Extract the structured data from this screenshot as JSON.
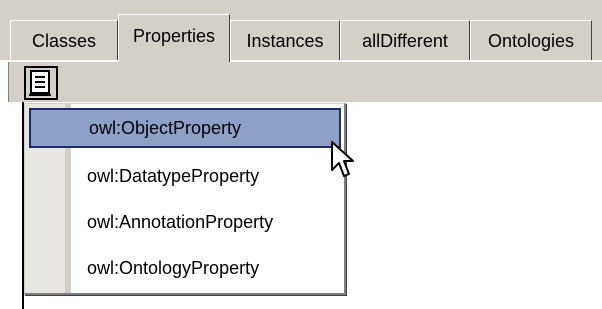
{
  "tabs": [
    {
      "label": "Classes",
      "active": false
    },
    {
      "label": "Properties",
      "active": true
    },
    {
      "label": "Instances",
      "active": false
    },
    {
      "label": "allDifferent",
      "active": false
    },
    {
      "label": "Ontologies",
      "active": false
    }
  ],
  "toolbar": {
    "button_icon": "list-icon"
  },
  "menu": {
    "items": [
      {
        "label": "owl:ObjectProperty",
        "highlighted": true
      },
      {
        "label": "owl:DatatypeProperty",
        "highlighted": false
      },
      {
        "label": "owl:AnnotationProperty",
        "highlighted": false
      },
      {
        "label": "owl:OntologyProperty",
        "highlighted": false
      }
    ]
  },
  "colors": {
    "chrome": "#d4d0c8",
    "highlight": "#8ea0c8",
    "highlight_border": "#1f2f6a"
  }
}
